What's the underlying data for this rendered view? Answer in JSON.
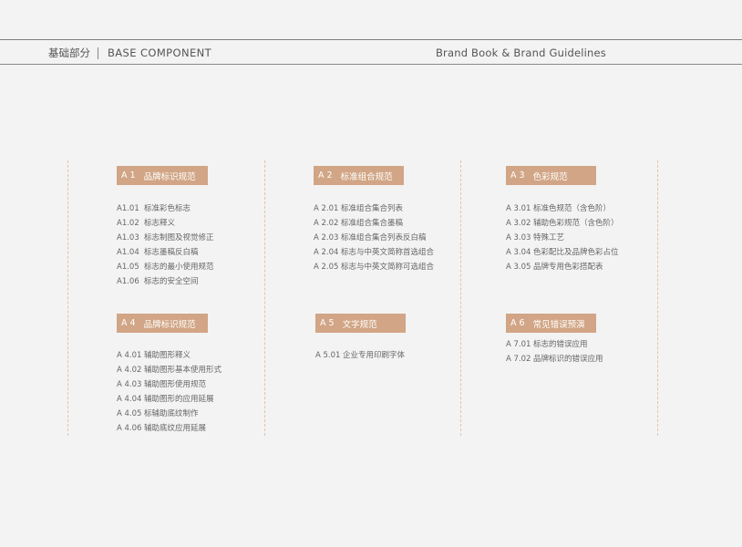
{
  "header": {
    "cn_title": "基础部分",
    "en_title": "BASE COMPONENT",
    "right_title": "Brand Book & Brand Guidelines"
  },
  "sections": [
    {
      "code": "A 1",
      "title": "品牌标识规范",
      "items": [
        {
          "code": "A1.01",
          "label": "标准彩色标志"
        },
        {
          "code": "A1.02",
          "label": "标志释义"
        },
        {
          "code": "A1.03",
          "label": "标志制图及视觉修正"
        },
        {
          "code": "A1.04",
          "label": "标志墨稿反白稿"
        },
        {
          "code": "A1.05",
          "label": "标志的最小使用规范"
        },
        {
          "code": "A1.06",
          "label": "标志的安全空间"
        }
      ]
    },
    {
      "code": "A 2",
      "title": "标准组合规范",
      "items": [
        {
          "code": "A 2.01",
          "label": "标准组合集合列表"
        },
        {
          "code": "A 2.02",
          "label": "标准组合集合墨稿"
        },
        {
          "code": "A 2.03",
          "label": "标准组合集合列表反白稿"
        },
        {
          "code": "A 2.04",
          "label": "标志与中英文简称首选组合"
        },
        {
          "code": "A 2.05",
          "label": "标志与中英文简称可选组合"
        }
      ]
    },
    {
      "code": "A 3",
      "title": "色彩规范",
      "items": [
        {
          "code": "A 3.01",
          "label": "标准色规范（含色阶）"
        },
        {
          "code": "A 3.02",
          "label": "辅助色彩规范（含色阶）"
        },
        {
          "code": "A 3.03",
          "label": "特殊工艺"
        },
        {
          "code": "A 3.04",
          "label": "色彩配比及品牌色彩占位"
        },
        {
          "code": "A 3.05",
          "label": "品牌专用色彩搭配表"
        }
      ]
    },
    {
      "code": "A 4",
      "title": "品牌标识规范",
      "items": [
        {
          "code": "A 4.01",
          "label": "辅助图形释义"
        },
        {
          "code": "A 4.02",
          "label": "辅助图形基本使用形式"
        },
        {
          "code": "A 4.03",
          "label": "辅助图形使用规范"
        },
        {
          "code": "A 4.04",
          "label": "辅助图形的应用延展"
        },
        {
          "code": "A 4.05",
          "label": "标辅助底纹制作"
        },
        {
          "code": "A 4.06",
          "label": "辅助底纹应用延展"
        }
      ]
    },
    {
      "code": "A 5",
      "title": "文字规范",
      "items": [
        {
          "code": "A 5.01",
          "label": "企业专用印刷字体"
        }
      ]
    },
    {
      "code": "A 6",
      "title": "常见错误预演",
      "items": [
        {
          "code": "A 7.01",
          "label": "标志的错误应用"
        },
        {
          "code": "A 7.02",
          "label": "品牌标识的错误应用"
        }
      ]
    }
  ],
  "colors": {
    "accent": "#d1a585",
    "background": "#f3f3f3",
    "divider": "#e0c4ad"
  }
}
